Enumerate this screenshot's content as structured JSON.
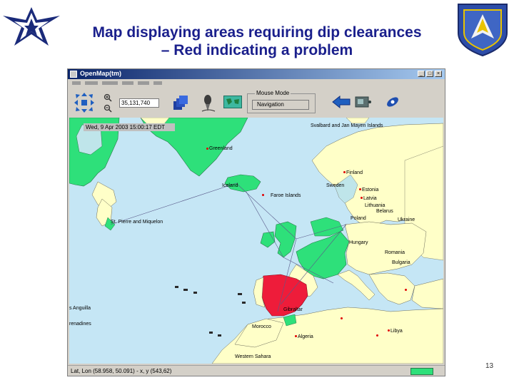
{
  "slide": {
    "title_line1": "Map displaying areas requiring dip clearances",
    "title_line2": "– Red indicating a problem",
    "page_number": "13"
  },
  "window": {
    "title": "OpenMap(tm)",
    "minimize": "_",
    "maximize": "□",
    "close": "×"
  },
  "toolbar": {
    "scale_value": "35,131,740",
    "mouse_mode_label": "Mouse Mode",
    "mouse_mode_value": "Navigation"
  },
  "map": {
    "timestamp": "Wed, 9 Apr 2003 15:00:17 EDT",
    "labels": {
      "svalbard": "Svalbard and Jan Mayen Islands",
      "greenland": "Greenland",
      "iceland": "Iceland",
      "faroe": "Faroe Islands",
      "finland": "Finland",
      "sweden": "Sweden",
      "estonia": "Estonia",
      "latvia": "Latvia",
      "lithuania": "Lithuania",
      "belarus": "Belarus",
      "ukraine": "Ukraine",
      "poland": "Poland",
      "hungary": "Hungary",
      "romania": "Romania",
      "bulgaria": "Bulgaria",
      "st_pierre": "St. Pierre and Miquelon",
      "gibraltar": "Gibraltar",
      "morocco": "Morocco",
      "algeria": "Algeria",
      "libya": "Libya",
      "western_sahara": "Western Sahara",
      "anguilla": "s Anguilla",
      "grenadines": "renadines"
    },
    "colors": {
      "ocean": "#c5e6f5",
      "land": "#ffffc8",
      "clear": "#2ee07a",
      "problem": "#ee1c3a"
    }
  },
  "status": {
    "coords": "Lat, Lon (58.958, 50.091) - x, y (543,62)"
  }
}
